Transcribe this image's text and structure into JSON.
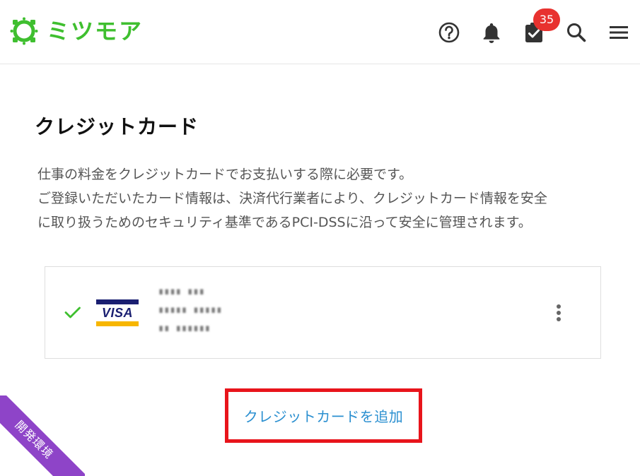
{
  "header": {
    "logo_text": "ミツモア",
    "icons": {
      "help": "help-circle-icon",
      "notifications": "bell-icon",
      "tasks": "clipboard-check-icon",
      "search": "search-icon",
      "menu": "hamburger-menu-icon"
    },
    "task_badge_count": "35"
  },
  "page": {
    "title": "クレジットカード",
    "description": [
      "仕事の料金をクレジットカードでお支払いする際に必要です。",
      "ご登録いただいたカード情報は、決済代行業者により、クレジットカード情報を安全",
      "に取り扱うためのセキュリティ基準であるPCI-DSSに沿って安全に管理されます。"
    ]
  },
  "card": {
    "selected_icon": "check-icon",
    "brand": "VISA",
    "details_blurred": [
      "∎∎∎∎ ∎∎∎",
      "∎∎∎∎∎ ∎∎∎∎∎",
      "∎∎ ∎∎∎∎∎∎"
    ],
    "menu_icon": "kebab-menu-icon"
  },
  "actions": {
    "add_card_label": "クレジットカードを追加"
  },
  "environment_ribbon": {
    "label": "開発環境"
  },
  "colors": {
    "brand_green": "#3fbf2f",
    "badge_red": "#e8322f",
    "link_blue": "#2a8fd0",
    "highlight_red": "#e8141b",
    "ribbon_purple": "#8e44c8"
  }
}
